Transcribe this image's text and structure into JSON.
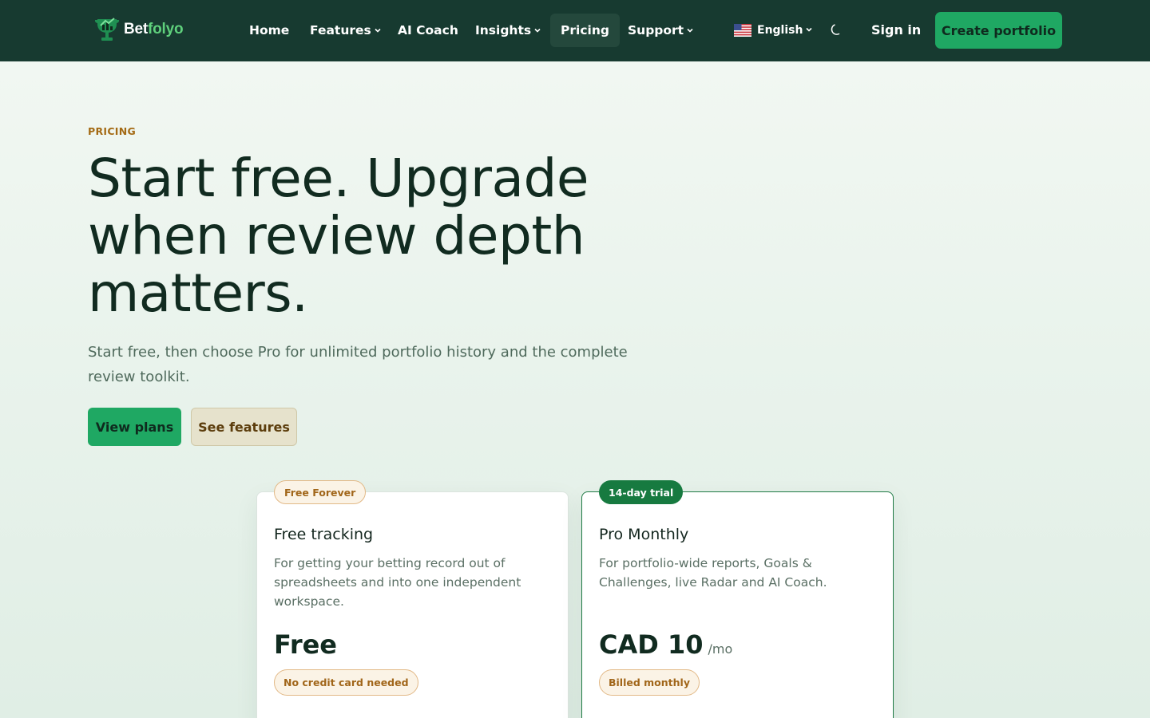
{
  "brand": {
    "name_a": "Bet",
    "name_b": "folyo",
    "icon": "trophy-chart-icon"
  },
  "nav": {
    "items": [
      {
        "label": "Home",
        "dropdown": false
      },
      {
        "label": "Features",
        "dropdown": true
      },
      {
        "label": "AI Coach",
        "dropdown": false
      },
      {
        "label": "Insights",
        "dropdown": true
      },
      {
        "label": "Pricing",
        "dropdown": false,
        "active": true
      },
      {
        "label": "Support",
        "dropdown": true
      }
    ],
    "language": {
      "label": "English",
      "flag": "us-flag-icon"
    },
    "theme_icon": "moon-icon",
    "signin_label": "Sign in",
    "cta_label": "Create portfolio"
  },
  "hero": {
    "eyebrow": "PRICING",
    "title": "Start free. Upgrade when review depth matters.",
    "subtitle": "Start free, then choose Pro for unlimited portfolio history and the complete review toolkit.",
    "primary_button": "View plans",
    "secondary_button": "See features"
  },
  "plans": [
    {
      "badge": "Free Forever",
      "title": "Free tracking",
      "description": "For getting your betting record out of spreadsheets and into one independent workspace.",
      "price": "Free",
      "period": "",
      "pill": "No credit card needed"
    },
    {
      "badge": "14-day trial",
      "title": "Pro Monthly",
      "description": "For portfolio-wide reports, Goals & Challenges, live Radar and AI Coach.",
      "price": "CAD 10",
      "period": "/mo",
      "pill": "Billed monthly"
    }
  ],
  "colors": {
    "nav_bg": "#173a30",
    "accent_green": "#1fa863",
    "brand_green": "#5fd07c",
    "eyebrow_amber": "#a46a14",
    "pro_border": "#1f7a45"
  }
}
